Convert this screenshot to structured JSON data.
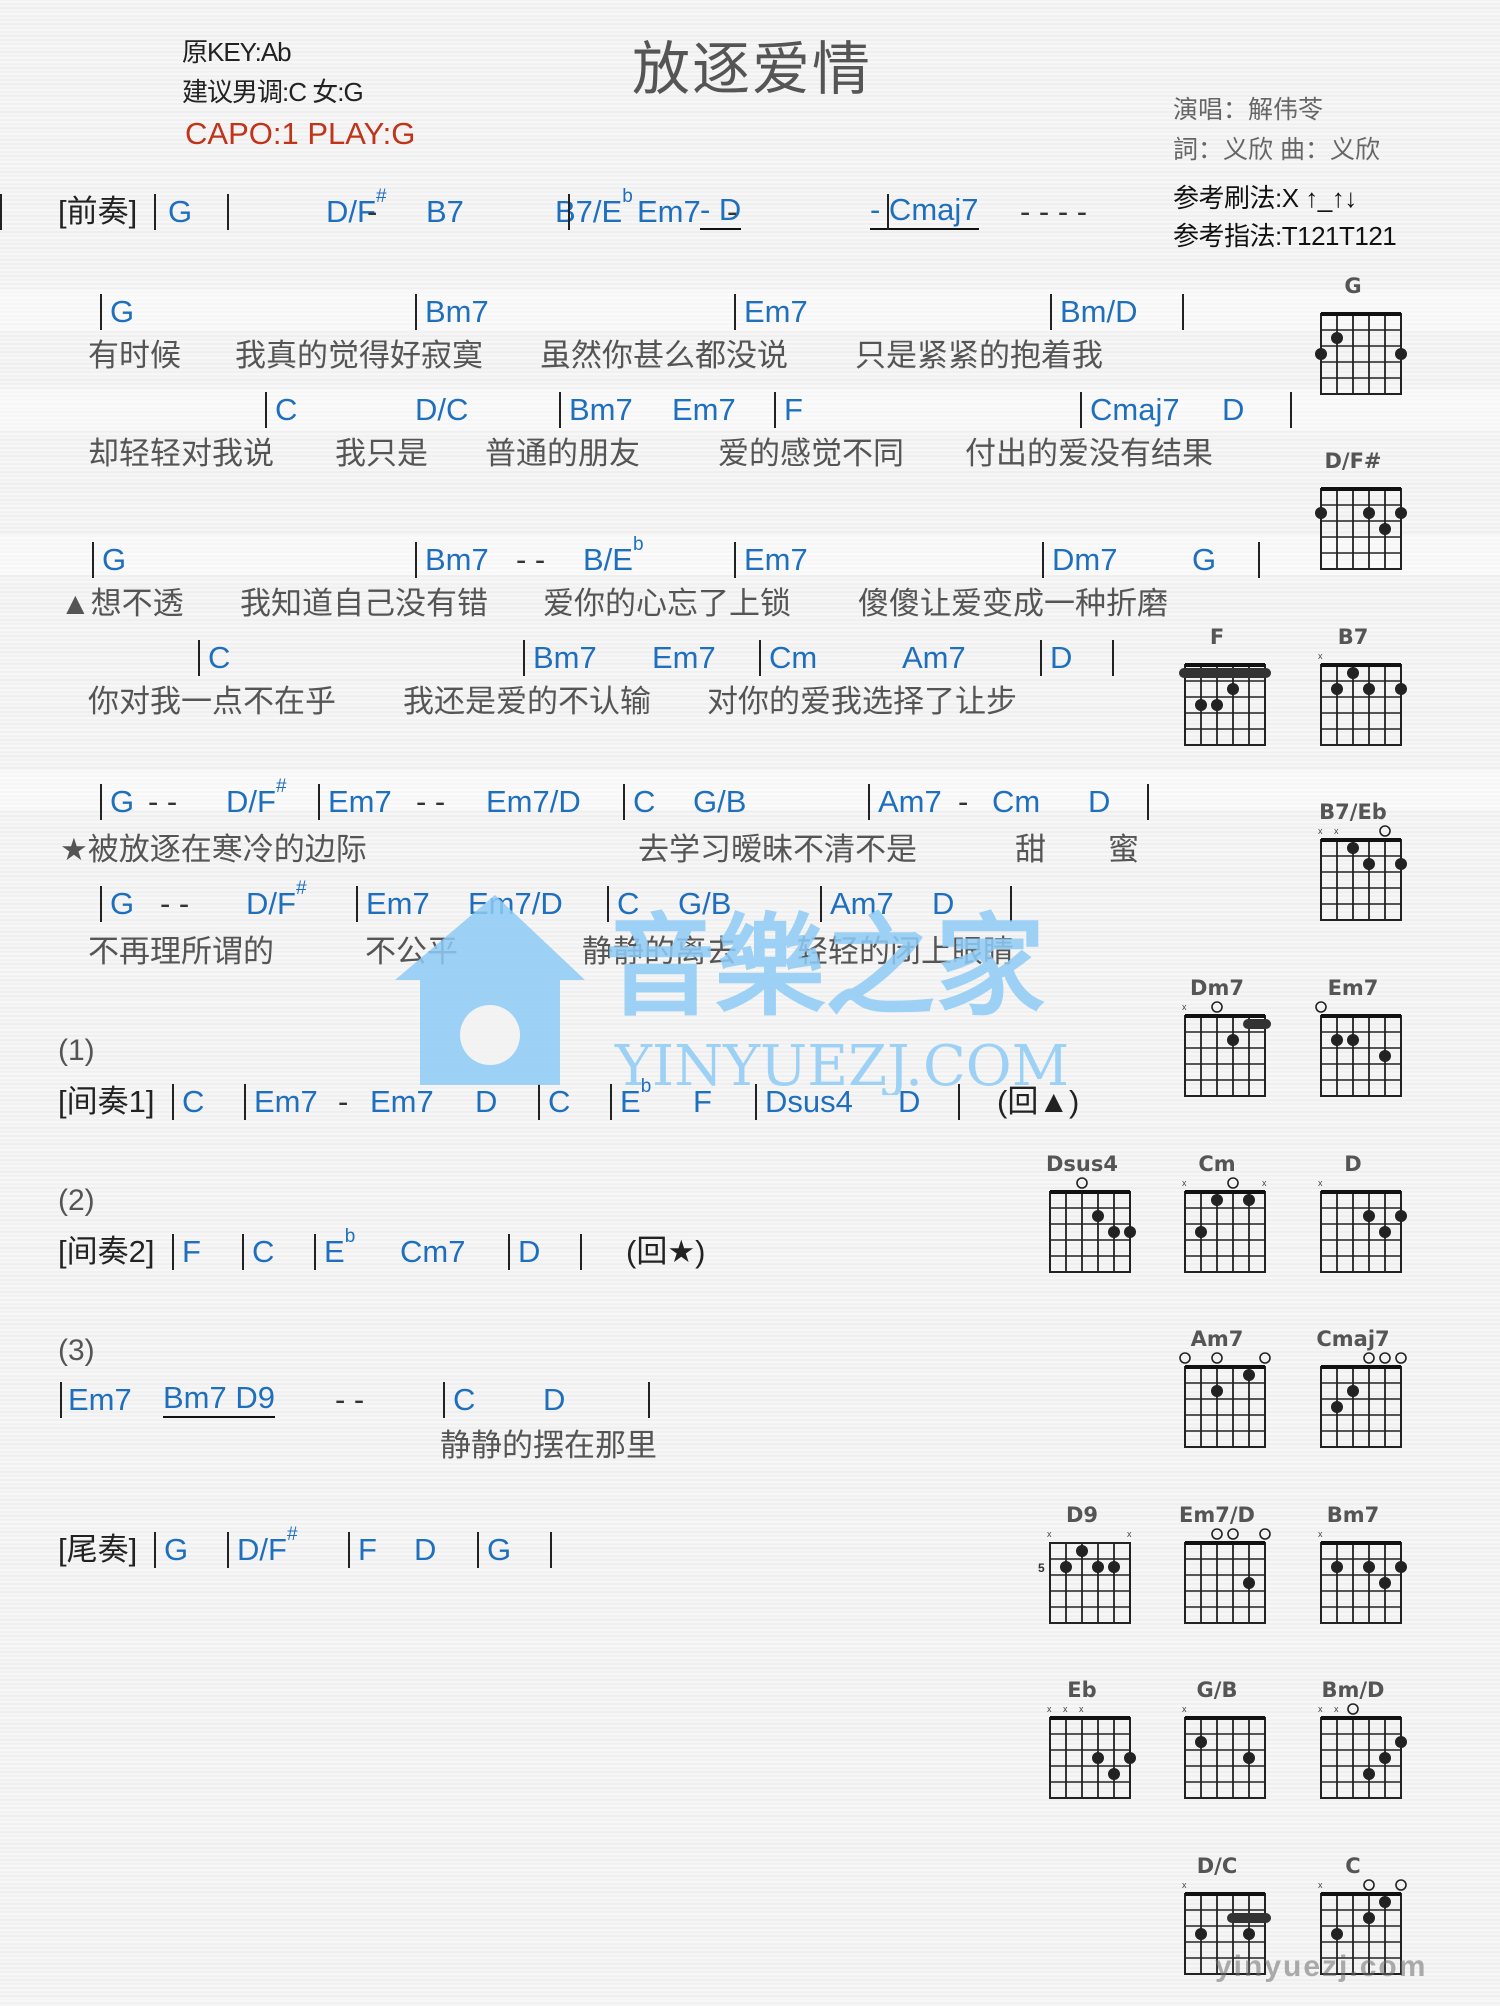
{
  "header": {
    "original_key": "原KEY:Ab",
    "suggested_key": "建议男调:C 女:G",
    "capo": "CAPO:1 PLAY:G",
    "title": "放逐爱情",
    "singer": "演唱：解伟苓",
    "writers": "詞：义欣   曲：义欣",
    "strum_pattern": "参考刷法:X ↑_↑↓",
    "finger_pattern": "参考指法:T121T121"
  },
  "rows": [
    {
      "id": "intro",
      "tokens": [
        {
          "t": "[前奏]",
          "k": "lbl"
        },
        {
          "t": "|",
          "k": "bar"
        },
        {
          "t": "G"
        },
        {
          "t": "|",
          "k": "bar"
        },
        {
          "t": "D/F",
          "sup": "#"
        },
        {
          "t": "-",
          "k": "dash"
        },
        {
          "t": "B7"
        },
        {
          "t": "B7/E",
          "sup": "b"
        },
        {
          "t": "|",
          "k": "bar"
        },
        {
          "t": "Em7"
        },
        {
          "t": "- D",
          "ul": true
        },
        {
          "t": "-",
          "k": "dash"
        },
        {
          "t": "- Cmaj7",
          "ul": true
        },
        {
          "t": "|",
          "k": "bar"
        },
        {
          "t": "-  -  -  -",
          "k": "dash"
        },
        {
          "t": "|",
          "k": "bar"
        }
      ]
    },
    {
      "id": "v1c1",
      "tokens": [
        {
          "t": "|",
          "k": "bar"
        },
        {
          "t": "G"
        },
        {
          "t": "|",
          "k": "bar"
        },
        {
          "t": "Bm7"
        },
        {
          "t": "|",
          "k": "bar"
        },
        {
          "t": "Em7"
        },
        {
          "t": "|",
          "k": "bar"
        },
        {
          "t": "Bm/D"
        },
        {
          "t": "|",
          "k": "bar"
        }
      ]
    },
    {
      "id": "v1c2",
      "tokens": [
        {
          "t": "|",
          "k": "bar"
        },
        {
          "t": "C"
        },
        {
          "t": "D/C"
        },
        {
          "t": "|",
          "k": "bar"
        },
        {
          "t": "Bm7"
        },
        {
          "t": "Em7"
        },
        {
          "t": "|",
          "k": "bar"
        },
        {
          "t": "F"
        },
        {
          "t": "|",
          "k": "bar"
        },
        {
          "t": "Cmaj7"
        },
        {
          "t": "D"
        },
        {
          "t": "|",
          "k": "bar"
        }
      ]
    },
    {
      "id": "v2c1",
      "tokens": [
        {
          "t": "|",
          "k": "bar"
        },
        {
          "t": "G"
        },
        {
          "t": "|",
          "k": "bar"
        },
        {
          "t": "Bm7"
        },
        {
          "t": "-  -",
          "k": "dash"
        },
        {
          "t": "B/E",
          "sup": "b"
        },
        {
          "t": "|",
          "k": "bar"
        },
        {
          "t": "Em7"
        },
        {
          "t": "|",
          "k": "bar"
        },
        {
          "t": "Dm7"
        },
        {
          "t": "G"
        },
        {
          "t": "|",
          "k": "bar"
        }
      ]
    },
    {
      "id": "v2c2",
      "tokens": [
        {
          "t": "|",
          "k": "bar"
        },
        {
          "t": "C"
        },
        {
          "t": "|",
          "k": "bar"
        },
        {
          "t": "Bm7"
        },
        {
          "t": "Em7"
        },
        {
          "t": "|",
          "k": "bar"
        },
        {
          "t": "Cm"
        },
        {
          "t": "Am7"
        },
        {
          "t": "|",
          "k": "bar"
        },
        {
          "t": "D"
        },
        {
          "t": "|",
          "k": "bar"
        }
      ]
    },
    {
      "id": "ch1",
      "tokens": [
        {
          "t": "|",
          "k": "bar"
        },
        {
          "t": "G"
        },
        {
          "t": "-   -",
          "k": "dash"
        },
        {
          "t": "D/F",
          "sup": "#"
        },
        {
          "t": "|",
          "k": "bar"
        },
        {
          "t": "Em7"
        },
        {
          "t": "-  -",
          "k": "dash"
        },
        {
          "t": "Em7/D"
        },
        {
          "t": "|",
          "k": "bar"
        },
        {
          "t": "C"
        },
        {
          "t": "G/B"
        },
        {
          "t": "|",
          "k": "bar"
        },
        {
          "t": "Am7"
        },
        {
          "t": "-",
          "k": "dash"
        },
        {
          "t": "Cm"
        },
        {
          "t": "D"
        },
        {
          "t": "|",
          "k": "bar"
        }
      ]
    },
    {
      "id": "ch2",
      "tokens": [
        {
          "t": "|",
          "k": "bar"
        },
        {
          "t": "G"
        },
        {
          "t": "-    -",
          "k": "dash"
        },
        {
          "t": "D/F",
          "sup": "#"
        },
        {
          "t": "|",
          "k": "bar"
        },
        {
          "t": "Em7"
        },
        {
          "t": "Em7/D"
        },
        {
          "t": "|",
          "k": "bar"
        },
        {
          "t": "C"
        },
        {
          "t": "G/B"
        },
        {
          "t": "|",
          "k": "bar"
        },
        {
          "t": "Am7"
        },
        {
          "t": "D"
        },
        {
          "t": "|",
          "k": "bar"
        }
      ]
    },
    {
      "id": "inter1",
      "tokens": [
        {
          "t": "[间奏1]",
          "k": "lbl"
        },
        {
          "t": "|",
          "k": "bar"
        },
        {
          "t": "C"
        },
        {
          "t": "|",
          "k": "bar"
        },
        {
          "t": "Em7"
        },
        {
          "t": "-",
          "k": "dash"
        },
        {
          "t": "Em7"
        },
        {
          "t": "D"
        },
        {
          "t": "|",
          "k": "bar"
        },
        {
          "t": "C"
        },
        {
          "t": "|",
          "k": "bar"
        },
        {
          "t": "E",
          "sup": "b"
        },
        {
          "t": "F"
        },
        {
          "t": "|",
          "k": "bar"
        },
        {
          "t": "Dsus4"
        },
        {
          "t": "D"
        },
        {
          "t": "|",
          "k": "bar"
        },
        {
          "t": "(回▲)",
          "k": "sym"
        }
      ]
    },
    {
      "id": "inter2",
      "tokens": [
        {
          "t": "[间奏2]",
          "k": "lbl"
        },
        {
          "t": "|",
          "k": "bar"
        },
        {
          "t": "F"
        },
        {
          "t": "|",
          "k": "bar"
        },
        {
          "t": "C"
        },
        {
          "t": "|",
          "k": "bar"
        },
        {
          "t": "E",
          "sup": "b"
        },
        {
          "t": "Cm7"
        },
        {
          "t": "|",
          "k": "bar"
        },
        {
          "t": "D"
        },
        {
          "t": "|",
          "k": "bar"
        },
        {
          "t": "(回★)",
          "k": "sym"
        }
      ]
    },
    {
      "id": "end1",
      "tokens": [
        {
          "t": "|",
          "k": "bar"
        },
        {
          "t": "Em7"
        },
        {
          "t": "Bm7   D9",
          "ul": true
        },
        {
          "t": "-    -",
          "k": "dash"
        },
        {
          "t": "|",
          "k": "bar"
        },
        {
          "t": "C"
        },
        {
          "t": "D"
        },
        {
          "t": "|",
          "k": "bar"
        }
      ]
    },
    {
      "id": "outro",
      "tokens": [
        {
          "t": "[尾奏]",
          "k": "lbl"
        },
        {
          "t": "|",
          "k": "bar"
        },
        {
          "t": "G"
        },
        {
          "t": "|",
          "k": "bar"
        },
        {
          "t": "D/F",
          "sup": "#"
        },
        {
          "t": "|",
          "k": "bar"
        },
        {
          "t": "F"
        },
        {
          "t": "D"
        },
        {
          "t": "|",
          "k": "bar"
        },
        {
          "t": "G"
        },
        {
          "t": "|",
          "k": "bar"
        }
      ]
    }
  ],
  "lyrics": {
    "v1l1": [
      "有时候",
      "我真的觉得好寂寞",
      "虽然你甚么都没说",
      "只是紧紧的抱着我"
    ],
    "v1l2": [
      "却轻轻对我说",
      "我只是",
      "普通的朋友",
      "爱的感觉不同",
      "付出的爱没有结果"
    ],
    "v2l1": [
      "▲想不透",
      "我知道自己没有错",
      "爱你的心忘了上锁",
      "傻傻让爱变成一种折磨"
    ],
    "v2l2": [
      "你对我一点不在乎",
      "我还是爱的不认输",
      "对你的爱我选择了让步"
    ],
    "ch1": [
      "★被放逐在寒冷的边际",
      "去学习暧昧不清不是",
      "甜",
      "蜜"
    ],
    "ch2": [
      "不再理所谓的",
      "不公平",
      "静静的离去",
      "轻轻的闭上眼睛"
    ],
    "end1": [
      "静静的摆在那里"
    ]
  },
  "sections": [
    "(1)",
    "(2)",
    "(3)"
  ],
  "chord_charts": [
    {
      "name": "G",
      "open": [],
      "muted": [],
      "dots": [
        [
          2,
          2
        ],
        [
          1,
          3
        ],
        [
          6,
          3
        ]
      ],
      "barre": null,
      "fret": null
    },
    {
      "name": "D/F#",
      "open": [],
      "muted": [],
      "dots": [
        [
          1,
          2
        ],
        [
          4,
          2
        ],
        [
          6,
          2
        ],
        [
          5,
          3
        ]
      ],
      "barre": null,
      "fret": null
    },
    {
      "name": "F",
      "open": [],
      "muted": [],
      "dots": [
        [
          4,
          2
        ],
        [
          2,
          3
        ],
        [
          3,
          3
        ]
      ],
      "barre": [
        1,
        6,
        1
      ],
      "fret": null
    },
    {
      "name": "B7",
      "open": [],
      "muted": [
        1
      ],
      "dots": [
        [
          3,
          1
        ],
        [
          2,
          2
        ],
        [
          4,
          2
        ],
        [
          6,
          2
        ]
      ],
      "barre": null,
      "fret": null
    },
    {
      "name": "B7/Eb",
      "open": [
        5
      ],
      "muted": [
        1,
        2
      ],
      "dots": [
        [
          3,
          1
        ],
        [
          4,
          2
        ],
        [
          6,
          2
        ]
      ],
      "barre": null,
      "fret": null
    },
    {
      "name": "Dm7",
      "open": [
        3
      ],
      "muted": [
        1
      ],
      "dots": [
        [
          4,
          2
        ]
      ],
      "barre": [
        5,
        6,
        1
      ],
      "fret": null
    },
    {
      "name": "Em7",
      "open": [
        1
      ],
      "muted": [],
      "dots": [
        [
          2,
          2
        ],
        [
          3,
          2
        ],
        [
          5,
          3
        ]
      ],
      "barre": null,
      "fret": null
    },
    {
      "name": "Dsus4",
      "open": [
        3
      ],
      "muted": [],
      "dots": [
        [
          4,
          2
        ],
        [
          5,
          3
        ],
        [
          6,
          3
        ]
      ],
      "barre": null,
      "fret": null
    },
    {
      "name": "Cm",
      "open": [
        4
      ],
      "muted": [
        1,
        6
      ],
      "dots": [
        [
          3,
          1
        ],
        [
          5,
          1
        ],
        [
          2,
          3
        ]
      ],
      "barre": null,
      "fret": null
    },
    {
      "name": "D",
      "open": [],
      "muted": [
        1
      ],
      "dots": [
        [
          4,
          2
        ],
        [
          6,
          2
        ],
        [
          5,
          3
        ]
      ],
      "barre": null,
      "fret": null
    },
    {
      "name": "Am7",
      "open": [
        1,
        3,
        6
      ],
      "muted": [],
      "dots": [
        [
          5,
          1
        ],
        [
          3,
          2
        ]
      ],
      "barre": null,
      "fret": null
    },
    {
      "name": "Cmaj7",
      "open": [
        4,
        5,
        6
      ],
      "muted": [],
      "dots": [
        [
          3,
          2
        ],
        [
          2,
          3
        ]
      ],
      "barre": null,
      "fret": null
    },
    {
      "name": "D9",
      "open": [],
      "muted": [
        1,
        6
      ],
      "dots": [
        [
          3,
          1
        ],
        [
          2,
          2
        ],
        [
          4,
          2
        ],
        [
          5,
          2
        ]
      ],
      "barre": null,
      "fret": "5"
    },
    {
      "name": "Em7/D",
      "open": [
        3,
        4,
        6
      ],
      "muted": [],
      "dots": [
        [
          5,
          3
        ]
      ],
      "barre": null,
      "fret": null
    },
    {
      "name": "Bm7",
      "open": [],
      "muted": [
        1
      ],
      "dots": [
        [
          2,
          2
        ],
        [
          4,
          2
        ],
        [
          6,
          2
        ],
        [
          5,
          3
        ]
      ],
      "barre": null,
      "fret": null
    },
    {
      "name": "Eb",
      "open": [],
      "muted": [
        1,
        2,
        3
      ],
      "dots": [
        [
          4,
          3
        ],
        [
          6,
          3
        ],
        [
          5,
          4
        ]
      ],
      "barre": null,
      "fret": null
    },
    {
      "name": "G/B",
      "open": [],
      "muted": [
        1
      ],
      "dots": [
        [
          2,
          2
        ],
        [
          5,
          3
        ]
      ],
      "barre": null,
      "fret": null
    },
    {
      "name": "Bm/D",
      "open": [
        3
      ],
      "muted": [
        1,
        2
      ],
      "dots": [
        [
          6,
          2
        ],
        [
          5,
          3
        ],
        [
          4,
          4
        ]
      ],
      "barre": null,
      "fret": null
    },
    {
      "name": "D/C",
      "open": [],
      "muted": [
        1
      ],
      "dots": [
        [
          2,
          3
        ],
        [
          5,
          3
        ]
      ],
      "barre": [
        4,
        6,
        2
      ],
      "fret": null
    },
    {
      "name": "C",
      "open": [
        4,
        6
      ],
      "muted": [
        1
      ],
      "dots": [
        [
          5,
          1
        ],
        [
          4,
          2
        ],
        [
          2,
          3
        ]
      ],
      "barre": null,
      "fret": null
    }
  ],
  "watermark": {
    "brand": "音樂之家",
    "url": "YINYUEZJ.COM",
    "corner": "yinyuezj.com"
  },
  "colors": {
    "chord": "#1f6fbf",
    "capo": "#c0341a",
    "lyric": "#555555"
  }
}
